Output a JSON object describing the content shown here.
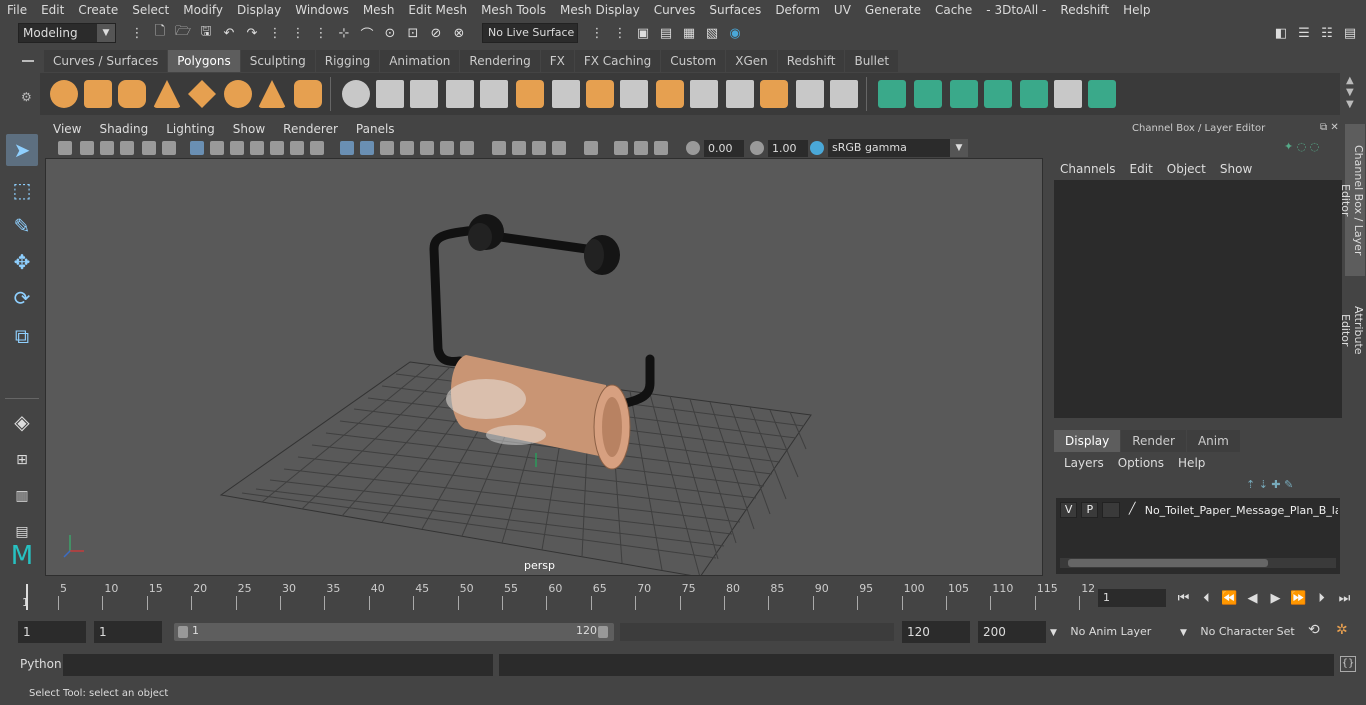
{
  "menubar": [
    "File",
    "Edit",
    "Create",
    "Select",
    "Modify",
    "Display",
    "Windows",
    "Mesh",
    "Edit Mesh",
    "Mesh Tools",
    "Mesh Display",
    "Curves",
    "Surfaces",
    "Deform",
    "UV",
    "Generate",
    "Cache",
    "- 3DtoAll -",
    "Redshift",
    "Help"
  ],
  "status_line": {
    "mode": "Modeling",
    "live_surface": "No Live Surface"
  },
  "shelf": {
    "tabs": [
      "Curves / Surfaces",
      "Polygons",
      "Sculpting",
      "Rigging",
      "Animation",
      "Rendering",
      "FX",
      "FX Caching",
      "Custom",
      "XGen",
      "Redshift",
      "Bullet"
    ],
    "active_tab": "Polygons"
  },
  "viewport": {
    "menus": [
      "View",
      "Shading",
      "Lighting",
      "Show",
      "Renderer",
      "Panels"
    ],
    "exposure": "0.00",
    "gamma_value": "1.00",
    "color_space": "sRGB gamma",
    "camera_label": "persp"
  },
  "channel_box": {
    "title": "Channel Box / Layer Editor",
    "menus": [
      "Channels",
      "Edit",
      "Object",
      "Show"
    ]
  },
  "layer_editor": {
    "tabs": [
      "Display",
      "Render",
      "Anim"
    ],
    "active_tab": "Display",
    "menus": [
      "Layers",
      "Options",
      "Help"
    ],
    "layer": {
      "v": "V",
      "p": "P",
      "name": "No_Toilet_Paper_Message_Plan_B_lay"
    }
  },
  "side_tabs": [
    "Channel Box / Layer Editor",
    "Attribute Editor"
  ],
  "timeline": {
    "ticks": [
      "5",
      "10",
      "15",
      "20",
      "25",
      "30",
      "35",
      "40",
      "45",
      "50",
      "55",
      "60",
      "65",
      "70",
      "75",
      "80",
      "85",
      "90",
      "95",
      "100",
      "105",
      "110",
      "115",
      "12"
    ],
    "start_mark": "1",
    "current_frame": "1"
  },
  "range": {
    "start": "1",
    "playback_start": "1",
    "slider_start": "1",
    "slider_end": "120",
    "playback_end": "120",
    "end": "200",
    "anim_layer": "No Anim Layer",
    "character_set": "No Character Set"
  },
  "command_line": {
    "label": "Python"
  },
  "help_line": "Select Tool: select an object"
}
